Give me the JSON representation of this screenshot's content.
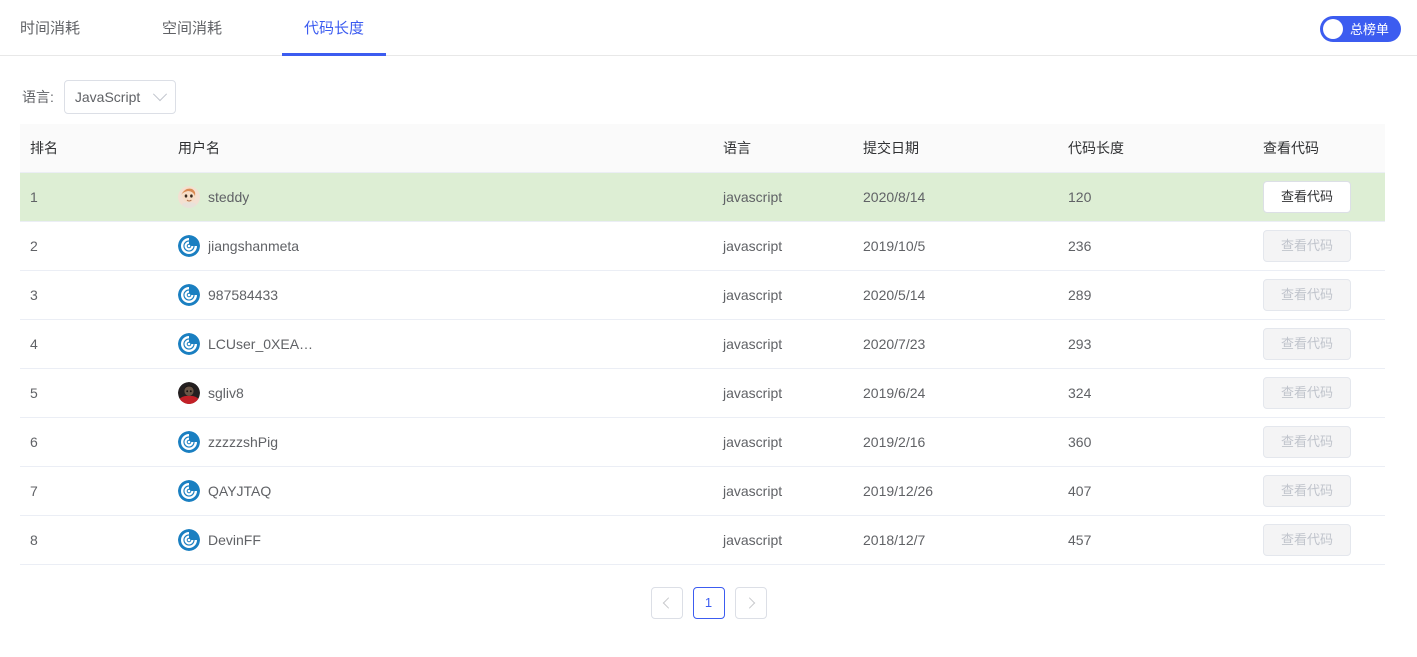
{
  "tabs": [
    {
      "label": "时间消耗",
      "active": false,
      "name": "tab-time-cost"
    },
    {
      "label": "空间消耗",
      "active": false,
      "name": "tab-space-cost"
    },
    {
      "label": "代码长度",
      "active": true,
      "name": "tab-code-length"
    }
  ],
  "toggle": {
    "label": "总榜单",
    "on": true,
    "color": "#3c5cf0"
  },
  "filter": {
    "label": "语言:",
    "selected": "JavaScript",
    "options": [
      "JavaScript"
    ]
  },
  "table": {
    "columns": [
      "排名",
      "用户名",
      "语言",
      "提交日期",
      "代码长度",
      "查看代码"
    ],
    "view_label": "查看代码",
    "highlight_color": "#ddeed4",
    "rows": [
      {
        "rank": "1",
        "user": "steddy",
        "avatar": "photo-steddy",
        "lang": "javascript",
        "date": "2020/8/14",
        "length": "120",
        "button_enabled": true,
        "highlight": true
      },
      {
        "rank": "2",
        "user": "jiangshanmeta",
        "avatar": "default-blue",
        "lang": "javascript",
        "date": "2019/10/5",
        "length": "236",
        "button_enabled": false,
        "highlight": false
      },
      {
        "rank": "3",
        "user": "987584433",
        "avatar": "default-blue",
        "lang": "javascript",
        "date": "2020/5/14",
        "length": "289",
        "button_enabled": false,
        "highlight": false
      },
      {
        "rank": "4",
        "user": "LCUser_0XEA…",
        "avatar": "default-blue",
        "lang": "javascript",
        "date": "2020/7/23",
        "length": "293",
        "button_enabled": false,
        "highlight": false
      },
      {
        "rank": "5",
        "user": "sgliv8",
        "avatar": "photo-sgliv8",
        "lang": "javascript",
        "date": "2019/6/24",
        "length": "324",
        "button_enabled": false,
        "highlight": false
      },
      {
        "rank": "6",
        "user": "zzzzzshPig",
        "avatar": "default-blue",
        "lang": "javascript",
        "date": "2019/2/16",
        "length": "360",
        "button_enabled": false,
        "highlight": false
      },
      {
        "rank": "7",
        "user": "QAYJTAQ",
        "avatar": "default-blue",
        "lang": "javascript",
        "date": "2019/12/26",
        "length": "407",
        "button_enabled": false,
        "highlight": false
      },
      {
        "rank": "8",
        "user": "DevinFF",
        "avatar": "default-blue",
        "lang": "javascript",
        "date": "2018/12/7",
        "length": "457",
        "button_enabled": false,
        "highlight": false
      }
    ]
  },
  "pagination": {
    "prev_icon": "chevron-left-icon",
    "next_icon": "chevron-right-icon",
    "pages": [
      "1"
    ],
    "current": "1",
    "prev_enabled": false,
    "next_enabled": false
  }
}
